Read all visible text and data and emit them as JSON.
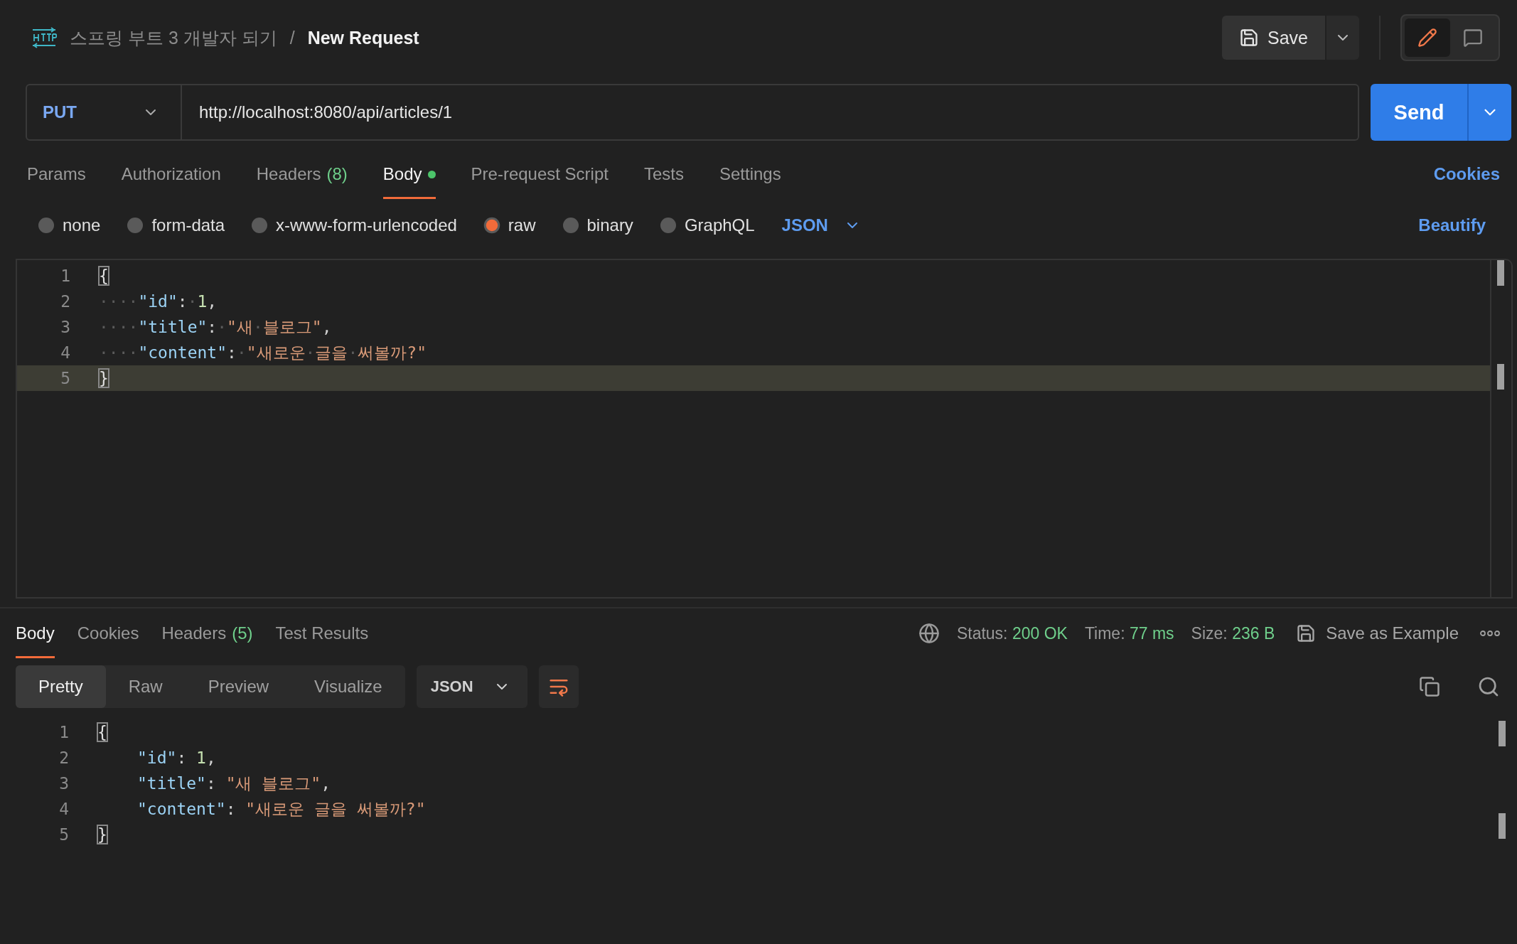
{
  "breadcrumb": {
    "collection": "스프링 부트 3 개발자 되기",
    "separator": "/",
    "request": "New Request"
  },
  "save_button": "Save",
  "view_modes": [
    {
      "kind": "edit",
      "selected": true
    },
    {
      "kind": "comment",
      "selected": false
    }
  ],
  "request": {
    "method": "PUT",
    "url": "http://localhost:8080/api/articles/1",
    "send": "Send"
  },
  "request_tabs": [
    {
      "label": "Params",
      "selected": false
    },
    {
      "label": "Authorization",
      "selected": false
    },
    {
      "label": "Headers",
      "count": "(8)",
      "selected": false
    },
    {
      "label": "Body",
      "selected": true,
      "modified": true
    },
    {
      "label": "Pre-request Script",
      "selected": false
    },
    {
      "label": "Tests",
      "selected": false
    },
    {
      "label": "Settings",
      "selected": false
    }
  ],
  "cookies_link": "Cookies",
  "body_types": [
    {
      "label": "none",
      "selected": false
    },
    {
      "label": "form-data",
      "selected": false
    },
    {
      "label": "x-www-form-urlencoded",
      "selected": false
    },
    {
      "label": "raw",
      "selected": true
    },
    {
      "label": "binary",
      "selected": false
    },
    {
      "label": "GraphQL",
      "selected": false
    }
  ],
  "body_format": "JSON",
  "beautify": "Beautify",
  "request_editor": {
    "lines": [
      {
        "number": "1",
        "tokens": [
          {
            "kind": "brace",
            "text": "{"
          }
        ]
      },
      {
        "number": "2",
        "tokens": [
          {
            "kind": "ws",
            "text": "····"
          },
          {
            "kind": "key",
            "text": "\"id\""
          },
          {
            "kind": "punct",
            "text": ":"
          },
          {
            "kind": "ws",
            "text": "·"
          },
          {
            "kind": "number",
            "text": "1"
          },
          {
            "kind": "punct",
            "text": ","
          }
        ]
      },
      {
        "number": "3",
        "tokens": [
          {
            "kind": "ws",
            "text": "····"
          },
          {
            "kind": "key",
            "text": "\"title\""
          },
          {
            "kind": "punct",
            "text": ":"
          },
          {
            "kind": "ws",
            "text": "·"
          },
          {
            "kind": "string",
            "text": "\"새"
          },
          {
            "kind": "ws",
            "text": "·"
          },
          {
            "kind": "string",
            "text": "블로그\""
          },
          {
            "kind": "punct",
            "text": ","
          }
        ]
      },
      {
        "number": "4",
        "tokens": [
          {
            "kind": "ws",
            "text": "····"
          },
          {
            "kind": "key",
            "text": "\"content\""
          },
          {
            "kind": "punct",
            "text": ":"
          },
          {
            "kind": "ws",
            "text": "·"
          },
          {
            "kind": "string",
            "text": "\"새로운"
          },
          {
            "kind": "ws",
            "text": "·"
          },
          {
            "kind": "string",
            "text": "글을"
          },
          {
            "kind": "ws",
            "text": "·"
          },
          {
            "kind": "string",
            "text": "써볼까?\""
          }
        ]
      },
      {
        "number": "5",
        "current": true,
        "tokens": [
          {
            "kind": "brace",
            "text": "}"
          }
        ]
      }
    ]
  },
  "response_tabs": [
    {
      "label": "Body",
      "selected": true
    },
    {
      "label": "Cookies",
      "selected": false
    },
    {
      "label": "Headers",
      "count": "(5)",
      "selected": false
    },
    {
      "label": "Test Results",
      "selected": false
    }
  ],
  "response_meta": [
    {
      "label": "Status:",
      "value": "200 OK"
    },
    {
      "label": "Time:",
      "value": "77 ms"
    },
    {
      "label": "Size:",
      "value": "236 B"
    }
  ],
  "save_as_example": "Save as Example",
  "response_views": [
    {
      "label": "Pretty",
      "selected": true
    },
    {
      "label": "Raw",
      "selected": false
    },
    {
      "label": "Preview",
      "selected": false
    },
    {
      "label": "Visualize",
      "selected": false
    }
  ],
  "response_format": "JSON",
  "wrap_lines": true,
  "response_editor": {
    "lines": [
      {
        "number": "1",
        "tokens": [
          {
            "kind": "brace",
            "text": "{"
          }
        ]
      },
      {
        "number": "2",
        "indented": true,
        "tokens": [
          {
            "kind": "key",
            "text": "\"id\""
          },
          {
            "kind": "punct",
            "text": ": "
          },
          {
            "kind": "number",
            "text": "1"
          },
          {
            "kind": "punct",
            "text": ","
          }
        ]
      },
      {
        "number": "3",
        "indented": true,
        "tokens": [
          {
            "kind": "key",
            "text": "\"title\""
          },
          {
            "kind": "punct",
            "text": ": "
          },
          {
            "kind": "string",
            "text": "\"새 블로그\""
          },
          {
            "kind": "punct",
            "text": ","
          }
        ]
      },
      {
        "number": "4",
        "indented": true,
        "tokens": [
          {
            "kind": "key",
            "text": "\"content\""
          },
          {
            "kind": "punct",
            "text": ": "
          },
          {
            "kind": "string",
            "text": "\"새로운 글을 써볼까?\""
          }
        ]
      },
      {
        "number": "5",
        "tokens": [
          {
            "kind": "brace",
            "text": "}"
          }
        ]
      }
    ]
  }
}
